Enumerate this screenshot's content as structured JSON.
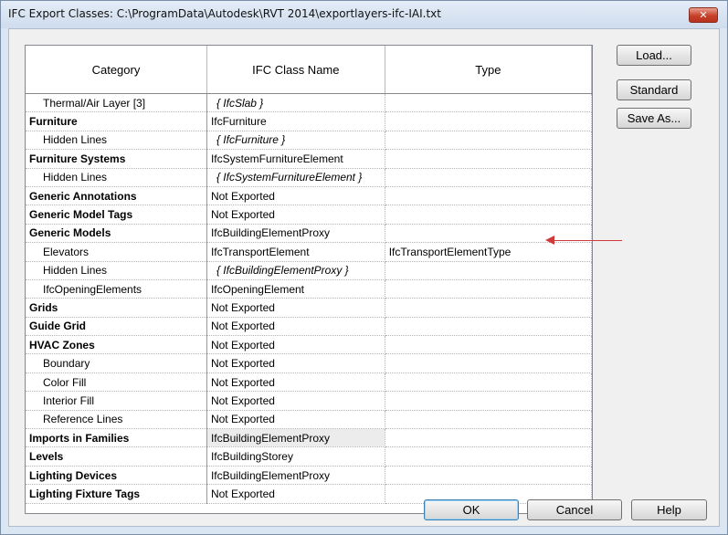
{
  "window": {
    "title": "IFC Export Classes: C:\\ProgramData\\Autodesk\\RVT 2014\\exportlayers-ifc-IAI.txt",
    "close_label": "✕"
  },
  "table": {
    "headers": [
      "Category",
      "IFC Class Name",
      "Type"
    ],
    "rows": [
      {
        "category": "Thermal/Air Layer [3]",
        "ifc": "{ IfcSlab }",
        "type": "",
        "level": "child",
        "ifc_style": "italic"
      },
      {
        "category": "Furniture",
        "ifc": "IfcFurniture",
        "type": "",
        "level": "parent",
        "ifc_style": "normal"
      },
      {
        "category": "Hidden Lines",
        "ifc": "{ IfcFurniture }",
        "type": "",
        "level": "child",
        "ifc_style": "italic"
      },
      {
        "category": "Furniture Systems",
        "ifc": "IfcSystemFurnitureElement",
        "type": "",
        "level": "parent",
        "ifc_style": "normal"
      },
      {
        "category": "Hidden Lines",
        "ifc": "{ IfcSystemFurnitureElement }",
        "type": "",
        "level": "child",
        "ifc_style": "italic"
      },
      {
        "category": "Generic Annotations",
        "ifc": "Not Exported",
        "type": "",
        "level": "parent",
        "ifc_style": "normal"
      },
      {
        "category": "Generic Model Tags",
        "ifc": "Not Exported",
        "type": "",
        "level": "parent",
        "ifc_style": "normal"
      },
      {
        "category": "Generic Models",
        "ifc": "IfcBuildingElementProxy",
        "type": "",
        "level": "parent",
        "ifc_style": "normal"
      },
      {
        "category": "Elevators",
        "ifc": "IfcTransportElement",
        "type": "IfcTransportElementType",
        "level": "child",
        "ifc_style": "normal"
      },
      {
        "category": "Hidden Lines",
        "ifc": "{ IfcBuildingElementProxy }",
        "type": "",
        "level": "child",
        "ifc_style": "italic"
      },
      {
        "category": "IfcOpeningElements",
        "ifc": "IfcOpeningElement",
        "type": "",
        "level": "child",
        "ifc_style": "normal"
      },
      {
        "category": "Grids",
        "ifc": "Not Exported",
        "type": "",
        "level": "parent",
        "ifc_style": "normal"
      },
      {
        "category": "Guide Grid",
        "ifc": "Not Exported",
        "type": "",
        "level": "parent",
        "ifc_style": "normal"
      },
      {
        "category": "HVAC Zones",
        "ifc": "Not Exported",
        "type": "",
        "level": "parent",
        "ifc_style": "normal"
      },
      {
        "category": "Boundary",
        "ifc": "Not Exported",
        "type": "",
        "level": "child",
        "ifc_style": "normal"
      },
      {
        "category": "Color Fill",
        "ifc": "Not Exported",
        "type": "",
        "level": "child",
        "ifc_style": "normal"
      },
      {
        "category": "Interior Fill",
        "ifc": "Not Exported",
        "type": "",
        "level": "child",
        "ifc_style": "normal"
      },
      {
        "category": "Reference Lines",
        "ifc": "Not Exported",
        "type": "",
        "level": "child",
        "ifc_style": "normal"
      },
      {
        "category": "Imports in Families",
        "ifc": "IfcBuildingElementProxy",
        "type": "",
        "level": "parent",
        "ifc_style": "gray"
      },
      {
        "category": "Levels",
        "ifc": "IfcBuildingStorey",
        "type": "",
        "level": "parent",
        "ifc_style": "normal"
      },
      {
        "category": "Lighting Devices",
        "ifc": "IfcBuildingElementProxy",
        "type": "",
        "level": "parent",
        "ifc_style": "normal"
      },
      {
        "category": "Lighting Fixture Tags",
        "ifc": "Not Exported",
        "type": "",
        "level": "parent",
        "ifc_style": "normal"
      }
    ]
  },
  "side_buttons": {
    "load": "Load...",
    "standard": "Standard",
    "save_as": "Save As..."
  },
  "footer_buttons": {
    "ok": "OK",
    "cancel": "Cancel",
    "help": "Help"
  },
  "annotation": {
    "arrow_color": "#d03a3a"
  }
}
